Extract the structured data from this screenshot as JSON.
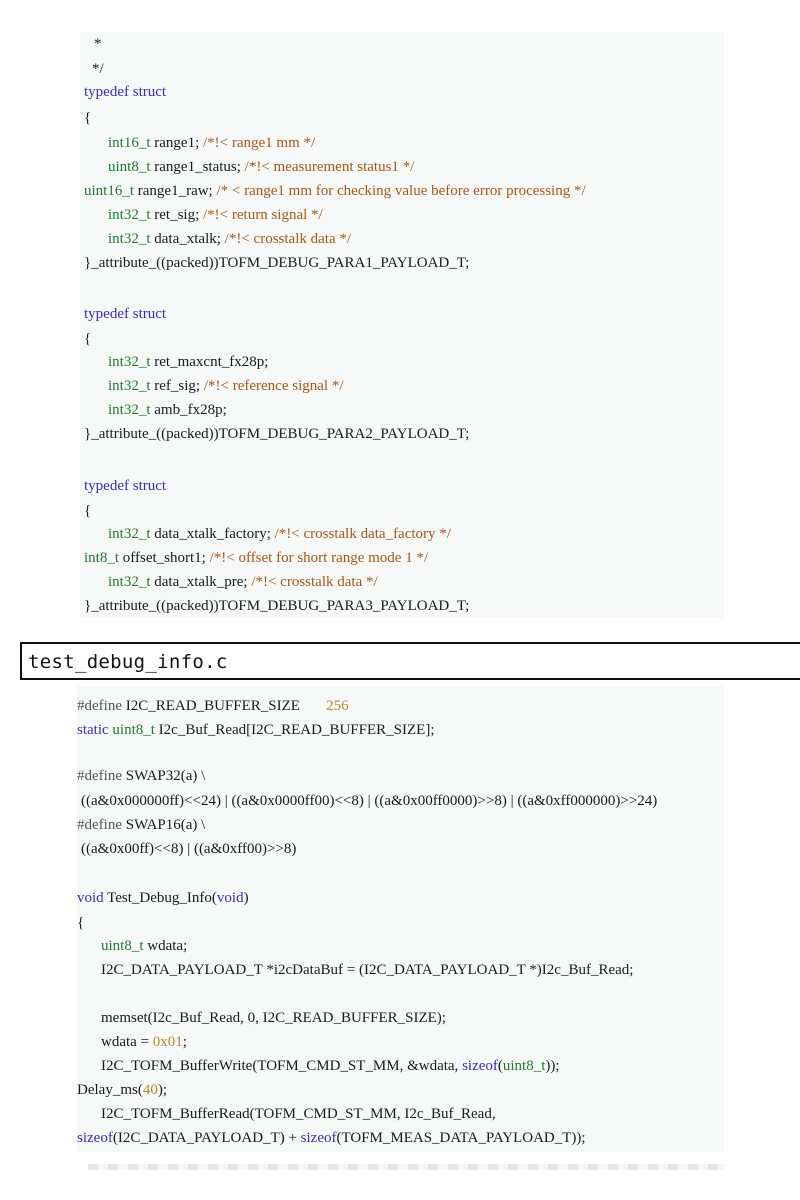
{
  "top_code": {
    "lines": [
      "*",
      "*/",
      "typedef struct",
      "{",
      "int16_t range1; /*!< range1 mm */",
      "uint8_t range1_status; /*!< measurement status1 */",
      "uint16_t range1_raw; /* < range1 mm for checking value before error processing */",
      "int32_t ret_sig; /*!< return signal */",
      "int32_t data_xtalk; /*!< crosstalk data */",
      "}_attribute_((packed))TOFM_DEBUG_PARA1_PAYLOAD_T;",
      "typedef struct",
      "{",
      "int32_t ret_maxcnt_fx28p;",
      "int32_t ref_sig; /*!< reference signal */",
      "int32_t amb_fx28p;",
      "}_attribute_((packed))TOFM_DEBUG_PARA2_PAYLOAD_T;",
      "typedef struct",
      "{",
      "int32_t data_xtalk_factory; /*!< crosstalk data_factory */",
      "int8_t offset_short1; /*!< offset for short range mode 1 */",
      "int32_t data_xtalk_pre; /*!< crosstalk data */",
      "}_attribute_((packed))TOFM_DEBUG_PARA3_PAYLOAD_T;"
    ]
  },
  "file_bar": {
    "filename": "test_debug_info.c"
  },
  "bottom_code": {
    "lines": [
      "#define I2C_READ_BUFFER_SIZE       256",
      "static uint8_t I2c_Buf_Read[I2C_READ_BUFFER_SIZE];",
      "#define SWAP32(a) \\",
      "((a&0x000000ff)<<24) | ((a&0x0000ff00)<<8) | ((a&0x00ff0000)>>8) | ((a&0xff000000)>>24)",
      "#define SWAP16(a) \\",
      "((a&0x00ff)<<8) | ((a&0xff00)>>8)",
      "void Test_Debug_Info(void)",
      "{",
      "uint8_t wdata;",
      "I2C_DATA_PAYLOAD_T *i2cDataBuf = (I2C_DATA_PAYLOAD_T *)I2c_Buf_Read;",
      "memset(I2c_Buf_Read, 0, I2C_READ_BUFFER_SIZE);",
      "wdata = 0x01;",
      "I2C_TOFM_BufferWrite(TOFM_CMD_ST_MM, &wdata, sizeof(uint8_t));",
      "Delay_ms(40);",
      "I2C_TOFM_BufferRead(TOFM_CMD_ST_MM, I2c_Buf_Read,",
      "sizeof(I2C_DATA_PAYLOAD_T) + sizeof(TOFM_MEAS_DATA_PAYLOAD_T));"
    ]
  },
  "colors": {
    "keyword": "#3a2db4",
    "type": "#1f7a30",
    "comment": "#a6571c",
    "code_background": "#f7f8f8"
  }
}
